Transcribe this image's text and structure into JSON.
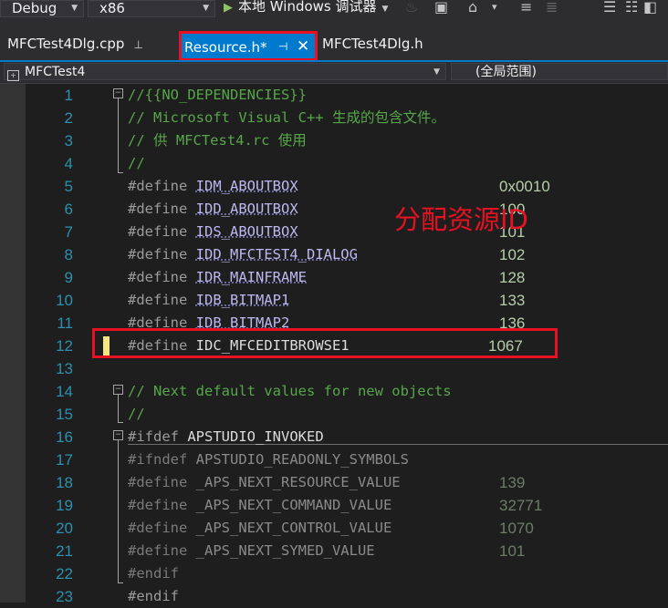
{
  "toolbar": {
    "config": "Debug",
    "platform": "x86",
    "run_label": "本地 Windows 调试器",
    "icons": [
      "fire-icon",
      "browse-icon",
      "home-icon",
      "format-icon",
      "comment-icon",
      "uncomment-icon",
      "bookmark-icon",
      "bookmark-next-icon"
    ]
  },
  "tabs": [
    {
      "label": "MFCTest4Dlg.cpp",
      "pinned": true
    },
    {
      "label": "Resource.h*",
      "active": true,
      "pinned": true
    },
    {
      "label": "MFCTest4Dlg.h"
    }
  ],
  "navbar": {
    "project": "MFCTest4",
    "scope": "(全局范围)"
  },
  "code": {
    "lines": [
      {
        "n": "1",
        "text": "//{{NO_DEPENDENCIES}}"
      },
      {
        "n": "2",
        "text": "// Microsoft Visual C++ 生成的包含文件。"
      },
      {
        "n": "3",
        "text": "// 供 MFCTest4.rc 使用"
      },
      {
        "n": "4",
        "text": "//"
      },
      {
        "n": "5",
        "kw": "#define",
        "name": "IDM_ABOUTBOX",
        "value": "0x0010"
      },
      {
        "n": "6",
        "kw": "#define",
        "name": "IDD_ABOUTBOX",
        "value": "100"
      },
      {
        "n": "7",
        "kw": "#define",
        "name": "IDS_ABOUTBOX",
        "value": "101"
      },
      {
        "n": "8",
        "kw": "#define",
        "name": "IDD_MFCTEST4_DIALOG",
        "value": "102"
      },
      {
        "n": "9",
        "kw": "#define",
        "name": "IDR_MAINFRAME",
        "value": "128"
      },
      {
        "n": "10",
        "kw": "#define",
        "name": "IDB_BITMAP1",
        "value": "133"
      },
      {
        "n": "11",
        "kw": "#define",
        "name": "IDB_BITMAP2",
        "value": "136"
      },
      {
        "n": "12",
        "kw": "#define",
        "name": "IDC_MFCEDITBROWSE1",
        "value": "1067"
      },
      {
        "n": "13"
      },
      {
        "n": "14",
        "text": "// Next default values for new objects"
      },
      {
        "n": "15",
        "text": "//"
      },
      {
        "n": "16",
        "kw": "#ifdef",
        "name": "APSTUDIO_INVOKED"
      },
      {
        "n": "17",
        "kw": "#ifndef",
        "name": "APSTUDIO_READONLY_SYMBOLS"
      },
      {
        "n": "18",
        "kw": "#define",
        "name": "_APS_NEXT_RESOURCE_VALUE",
        "value": "139"
      },
      {
        "n": "19",
        "kw": "#define",
        "name": "_APS_NEXT_COMMAND_VALUE",
        "value": "32771"
      },
      {
        "n": "20",
        "kw": "#define",
        "name": "_APS_NEXT_CONTROL_VALUE",
        "value": "1070"
      },
      {
        "n": "21",
        "kw": "#define",
        "name": "_APS_NEXT_SYMED_VALUE",
        "value": "101"
      },
      {
        "n": "22",
        "kw": "#endif"
      },
      {
        "n": "23",
        "kw": "#endif"
      }
    ]
  },
  "annotation": "分配资源ID",
  "colors": {
    "accent": "#007acc",
    "highlight_box": "#e81123",
    "comment": "#57a64a",
    "macro": "#bdb8f2",
    "number": "#b5cea8",
    "line_number": "#2b91af",
    "change_bar": "#f5e680"
  }
}
